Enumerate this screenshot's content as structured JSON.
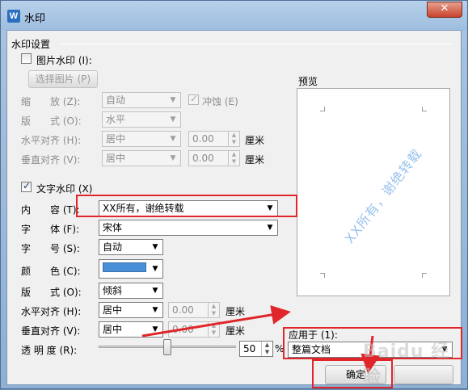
{
  "window": {
    "title": "水印",
    "app_icon": "W",
    "close_glyph": "✕"
  },
  "watermark_settings": {
    "group_title": "水印设置",
    "image_watermark": {
      "label": "图片水印 (I):",
      "checked": false,
      "select_image_button": "选择图片 (P)",
      "scale_label": "缩　　放 (Z):",
      "scale_value": "自动",
      "washout_label": "冲蚀 (E)",
      "washout_checked": true,
      "layout_label": "版　　式 (O):",
      "layout_value": "水平",
      "h_align_label": "水平对齐 (H):",
      "h_align_value": "居中",
      "h_offset": "0.00",
      "h_unit": "厘米",
      "v_align_label": "垂直对齐 (V):",
      "v_align_value": "居中",
      "v_offset": "0.00",
      "v_unit": "厘米"
    },
    "text_watermark": {
      "label": "文字水印 (X)",
      "checked": true,
      "content_label": "内　　容 (T):",
      "content_value": "XX所有，谢绝转载",
      "font_label": "字　　体 (F):",
      "font_value": "宋体",
      "size_label": "字　　号 (S):",
      "size_value": "自动",
      "color_label": "颜　　色 (C):",
      "color_value": "#4a90d9",
      "layout_label": "版　　式 (O):",
      "layout_value": "倾斜",
      "h_align_label": "水平对齐 (H):",
      "h_align_value": "居中",
      "h_offset": "0.00",
      "h_unit": "厘米",
      "v_align_label": "垂直对齐 (V):",
      "v_align_value": "居中",
      "v_offset": "0.00",
      "v_unit": "厘米",
      "transparency_label": "透 明 度 (R):",
      "transparency_value": "50",
      "transparency_fraction": 0.5,
      "transparency_unit": "%"
    }
  },
  "preview": {
    "label": "预览",
    "watermark_text": "XX所有，谢绝转载"
  },
  "apply_to": {
    "label": "应用于 (1):",
    "value": "整篇文档"
  },
  "buttons": {
    "ok": "确定"
  },
  "annotations": {
    "highlight_color": "#e0262a",
    "arrow_color": "#e0262a"
  }
}
